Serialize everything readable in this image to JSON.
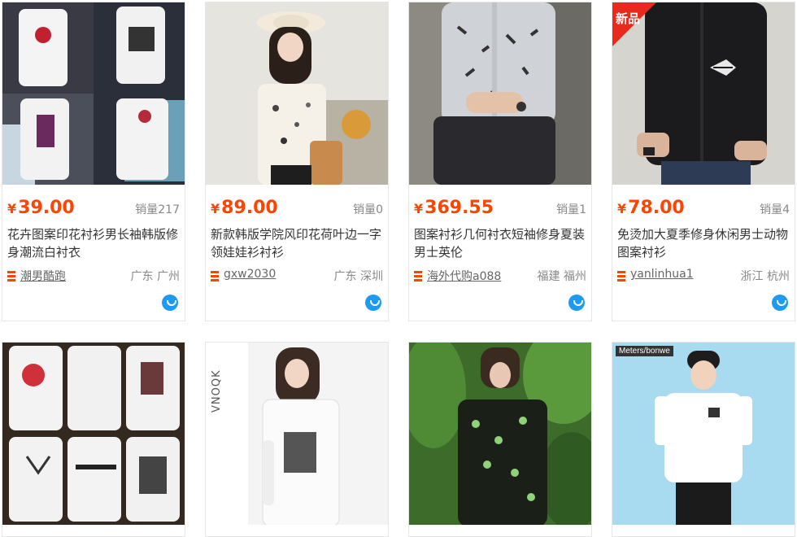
{
  "products": [
    {
      "price": "39.00",
      "sales": "销量217",
      "title": "花卉图案印花衬衫男长袖韩版修身潮流白衬衣",
      "shop": "潮男酷跑",
      "location": "广东 广州"
    },
    {
      "price": "89.00",
      "sales": "销量0",
      "title": "新款韩版学院风印花荷叶边一字领娃娃衫衬衫",
      "shop": "gxw2030",
      "location": "广东 深圳"
    },
    {
      "price": "369.55",
      "sales": "销量1",
      "title": "图案衬衫几何衬衣短袖修身夏装男士英伦",
      "shop": "海外代购a088",
      "location": "福建 福州"
    },
    {
      "price": "78.00",
      "sales": "销量4",
      "title": "免烫加大夏季修身休闲男士动物图案衬衫",
      "shop": "yanlinhua1",
      "location": "浙江 杭州",
      "badge": "新品"
    }
  ],
  "currency": "¥",
  "image_texts": {
    "brand_tag": "Meters/bonwe",
    "vertical_brand": "VNOQK"
  },
  "colors": {
    "price": "#ff4400",
    "badge": "#e8291c",
    "wangwang": "#1e9bf0"
  }
}
